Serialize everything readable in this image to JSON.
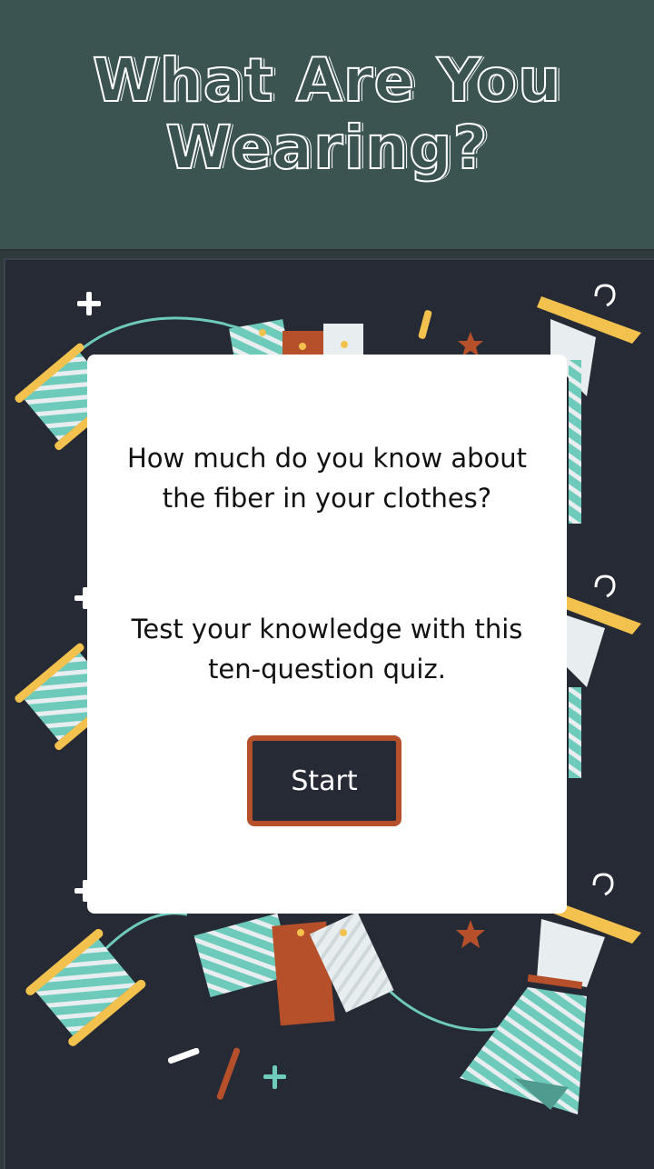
{
  "header": {
    "title": "What Are You Wearing?"
  },
  "intro": {
    "question": "How much do you know about the fiber in your clothes?",
    "description": "Test your knowledge with this ten-question quiz."
  },
  "start_button": {
    "label": "Start"
  },
  "colors": {
    "header_bg": "#3b5351",
    "stage_bg": "#262a35",
    "teal": "#6ecbbb",
    "rust": "#b5502b",
    "yellow": "#f2c14e",
    "card_bg": "#ffffff"
  }
}
